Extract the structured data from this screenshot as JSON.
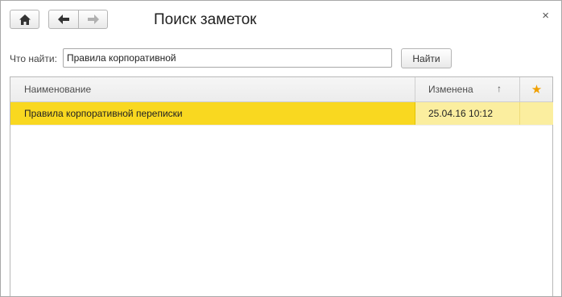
{
  "window": {
    "title": "Поиск заметок",
    "close_glyph": "×"
  },
  "toolbar": {
    "home_icon": "home-icon",
    "back_icon": "arrow-left-icon",
    "forward_icon": "arrow-right-icon"
  },
  "search": {
    "label": "Что найти:",
    "value": "Правила корпоративной",
    "button_label": "Найти"
  },
  "table": {
    "columns": [
      {
        "label": "Наименование"
      },
      {
        "label": "Изменена",
        "sort_glyph": "↑"
      },
      {
        "label": "★"
      }
    ],
    "rows": [
      {
        "name": "Правила корпоративной переписки",
        "changed": "25.04.16 10:12",
        "starred": false
      }
    ]
  },
  "colors": {
    "selected_row": "#f9d820",
    "selected_row_light": "#fbee9f",
    "star": "#f0a000"
  }
}
